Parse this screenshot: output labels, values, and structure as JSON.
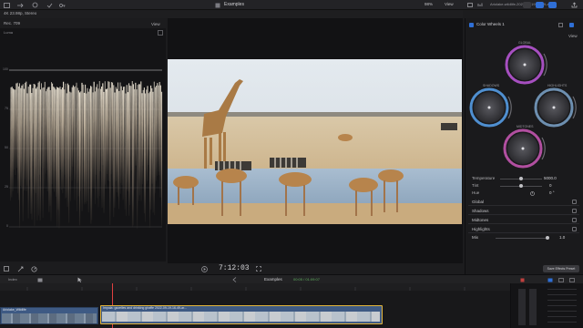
{
  "toolbar": {
    "format": "4K 23.98p, Stereo",
    "library_label": "Examples",
    "zoom": "98%",
    "view_label": "View",
    "clip_name": "Ariolake-wildlife-2022-09-19-09-49-ar..."
  },
  "scopes": {
    "title": "Rec. 709",
    "view_label": "View",
    "channel": "Luma",
    "ticks": [
      "100",
      "75",
      "50",
      "25",
      "0"
    ]
  },
  "inspector": {
    "effect_name": "Color Wheels 1",
    "view_label": "View",
    "wheels": [
      {
        "name": "GLOBAL",
        "color": "#a64fc0"
      },
      {
        "name": "SHADOWS",
        "color": "#4f8fd0"
      },
      {
        "name": "HIGHLIGHTS",
        "color": "#6d8fb0"
      },
      {
        "name": "MIDTONES",
        "color": "#b14fa0"
      }
    ],
    "params": [
      {
        "label": "Temperature",
        "value": "5000.0",
        "level": 0.5
      },
      {
        "label": "Tint",
        "value": "0",
        "level": 0.5
      },
      {
        "label": "Hue",
        "value": "0 °",
        "level": 0.0
      }
    ],
    "sections": [
      "Global",
      "Shadows",
      "Midtones",
      "Highlights"
    ],
    "mix_label": "Mix",
    "mix_value": "1.0",
    "save_preset_label": "Save Effects Preset"
  },
  "viewer": {
    "timecode": "7:12:03",
    "timeline_name": "Examples",
    "timeline_duration": "00:05 / 01:09:07",
    "index_label": "Index"
  },
  "timeline": {
    "clip1_title": "Ariolake_Wildlife",
    "clip2_title": "Impala: gazelles and drinking giraffe 2022-09-19-16-49-ar..."
  },
  "colors": {
    "accent": "#2f6fd6",
    "playhead": "#e04040",
    "clip_selected_border": "#e3b53b",
    "audio_meter": "#3a3a3e"
  }
}
